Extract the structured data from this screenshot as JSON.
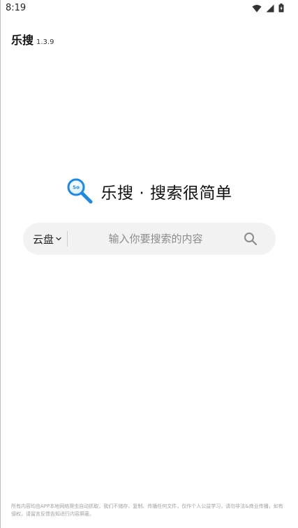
{
  "status_bar": {
    "time": "8:19",
    "icons": [
      "wifi-icon",
      "signal-icon",
      "battery-icon"
    ]
  },
  "header": {
    "app_name": "乐搜",
    "version": "1.3.9"
  },
  "hero": {
    "logo": "magnifier-logo-icon",
    "title": "乐搜 · 搜索很简单",
    "logo_text": "So"
  },
  "search": {
    "scope_label": "云盘",
    "placeholder": "输入你要搜索的内容",
    "value": "",
    "button_icon": "search-icon"
  },
  "footer": {
    "disclaimer": "所有内容均由APP本地网络爬虫自动抓取，我们不储存、复制、传播任何文件，仅作个人公益学习，请勿非法&商业传播，如有侵权，请留言反馈告知进行内容屏蔽。"
  },
  "colors": {
    "background": "#ffffff",
    "search_bg": "#f2f2f2",
    "logo_blue": "#1e88e5",
    "text": "#111111",
    "placeholder": "#8c8c8c",
    "disclaimer": "#a0a0a0"
  }
}
